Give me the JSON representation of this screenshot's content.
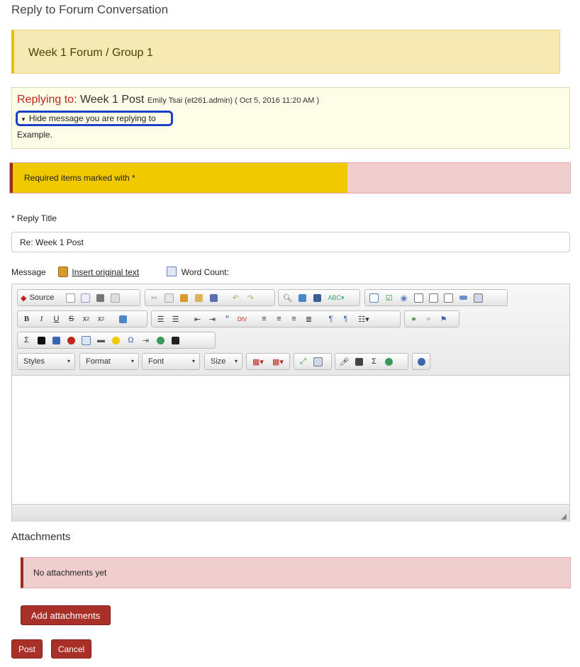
{
  "page": {
    "title": "Reply to Forum Conversation"
  },
  "forum": {
    "name": "Week 1 Forum / Group 1"
  },
  "reply": {
    "label": "Replying to:",
    "title": "Week 1 Post",
    "meta": "Emily Tsai (et261.admin) ( Oct 5, 2016 11:20 AM )",
    "toggle": "Hide message you are replying to",
    "body": "Example."
  },
  "required": {
    "text": "Required items marked with *"
  },
  "form": {
    "reply_title_label": "* Reply Title",
    "reply_title_value": "Re: Week 1 Post",
    "message_label": "Message",
    "insert_link": "Insert original text",
    "word_count": "Word Count:"
  },
  "editor": {
    "source_label": "Source",
    "combos": [
      "Styles",
      "Format",
      "Font",
      "Size"
    ]
  },
  "attachments": {
    "title": "Attachments",
    "empty_text": "No attachments yet",
    "add_button": "Add attachments"
  },
  "actions": {
    "post": "Post",
    "cancel": "Cancel"
  },
  "colors": {
    "accent": "#a83028",
    "notice": "#f0c900",
    "focus_ring": "#1a3fc9"
  }
}
